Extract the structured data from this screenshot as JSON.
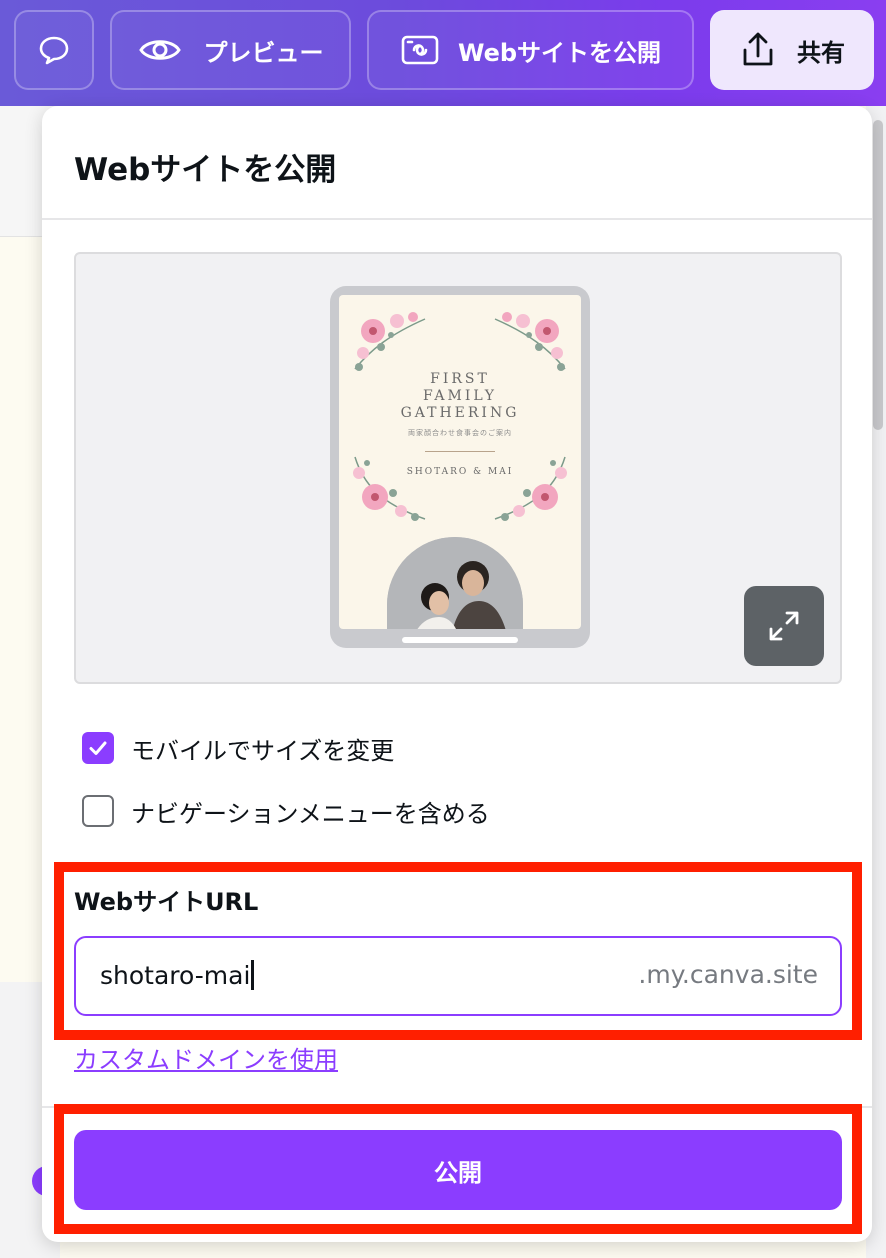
{
  "toolbar": {
    "preview_label": "プレビュー",
    "publish_website_label": "Webサイトを公開",
    "share_label": "共有"
  },
  "panel": {
    "title": "Webサイトを公開",
    "preview": {
      "site_title_lines": [
        "FIRST",
        "FAMILY",
        "GATHERING"
      ],
      "site_subtitle": "両家顔合わせ食事会のご案内",
      "site_names": "SHOTARO & MAI"
    },
    "options": {
      "resize_mobile_label": "モバイルでサイズを変更",
      "resize_mobile_checked": true,
      "include_nav_label": "ナビゲーションメニューを含める",
      "include_nav_checked": false
    },
    "url_section": {
      "label": "WebサイトURL",
      "value": "shotaro-mai",
      "suffix": ".my.canva.site"
    },
    "custom_domain_link": "カスタムドメインを使用",
    "publish_button": "公開"
  },
  "colors": {
    "accent": "#8b3dff",
    "highlight": "#ff1f00",
    "toolbar_start": "#6a5ad8",
    "toolbar_end": "#8a3ef0"
  }
}
